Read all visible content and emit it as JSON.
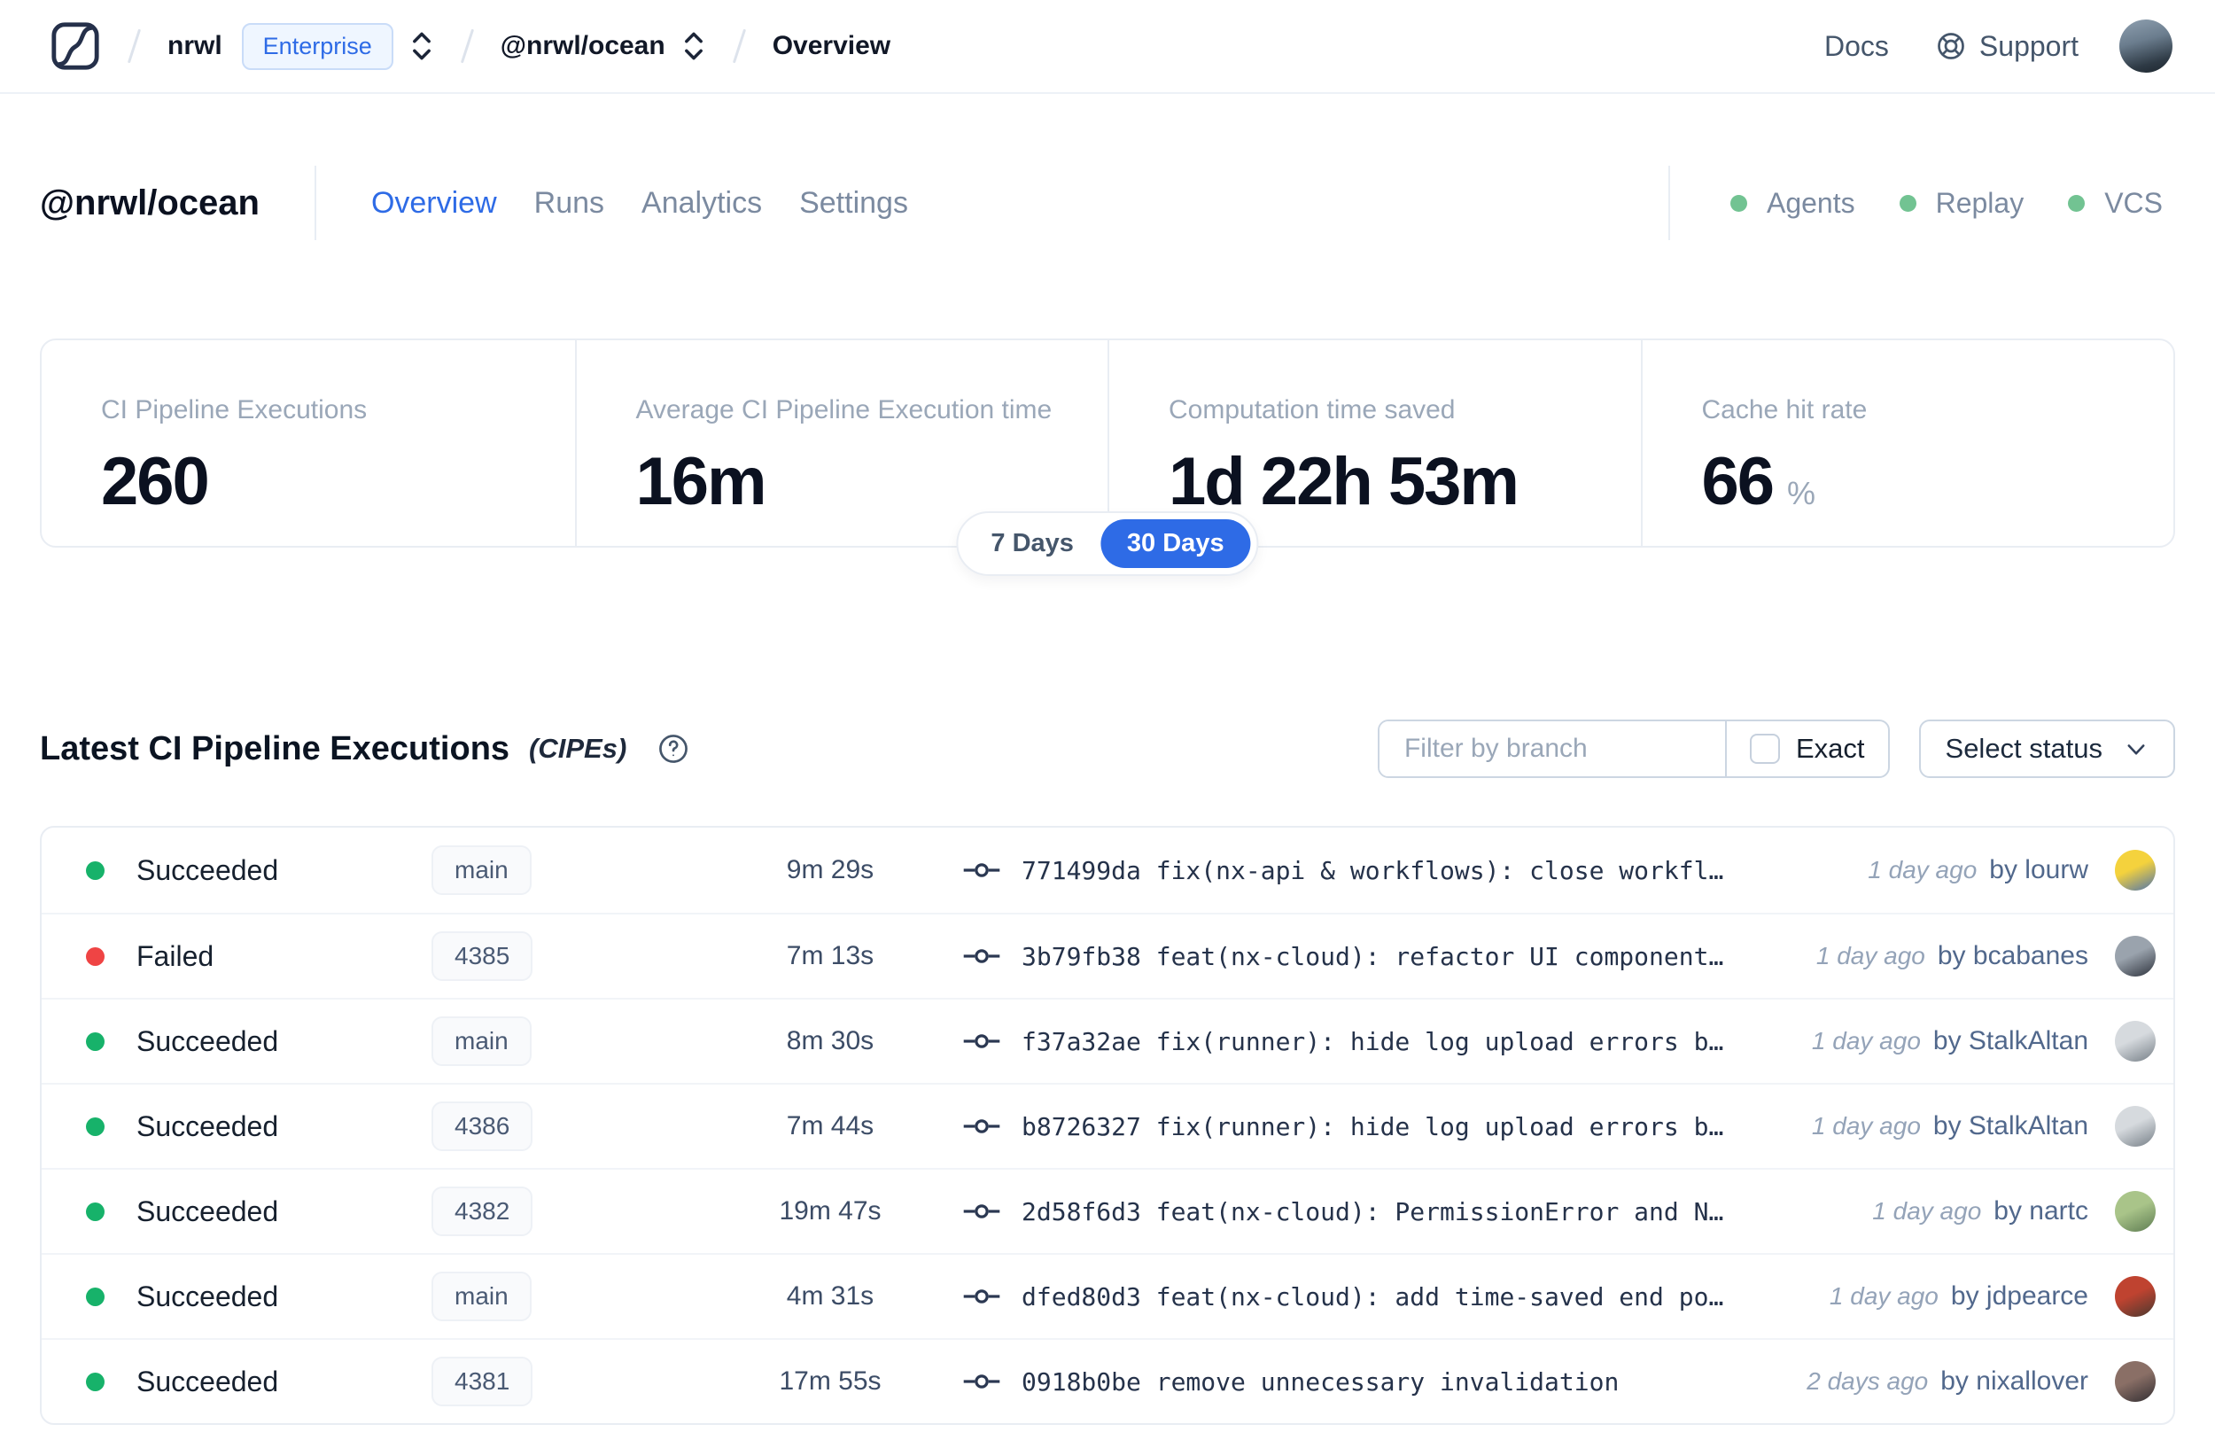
{
  "nav": {
    "breadcrumb": {
      "org": "nrwl",
      "org_badge": "Enterprise",
      "workspace": "@nrwl/ocean",
      "page": "Overview"
    },
    "docs_label": "Docs",
    "support_label": "Support"
  },
  "workspace": {
    "title": "@nrwl/ocean",
    "tabs": [
      {
        "label": "Overview",
        "active": true
      },
      {
        "label": "Runs",
        "active": false
      },
      {
        "label": "Analytics",
        "active": false
      },
      {
        "label": "Settings",
        "active": false
      }
    ],
    "indicators": [
      {
        "label": "Agents"
      },
      {
        "label": "Replay"
      },
      {
        "label": "VCS"
      }
    ]
  },
  "stats": {
    "cards": [
      {
        "label": "CI Pipeline Executions",
        "value": "260",
        "suffix": ""
      },
      {
        "label": "Average CI Pipeline Execution time",
        "value": "16m",
        "suffix": ""
      },
      {
        "label": "Computation time saved",
        "value": "1d 22h 53m",
        "suffix": ""
      },
      {
        "label": "Cache hit rate",
        "value": "66",
        "suffix": "%"
      }
    ],
    "range_toggle": {
      "options": [
        "7 Days",
        "30 Days"
      ],
      "selected": "30 Days"
    }
  },
  "cipe_section": {
    "title": "Latest CI Pipeline Executions",
    "title_suffix": "(CIPEs)",
    "filter": {
      "branch_placeholder": "Filter by branch",
      "exact_label": "Exact",
      "status_label": "Select status"
    },
    "rows": [
      {
        "status": "Succeeded",
        "failed": false,
        "branch": "main",
        "duration": "9m 29s",
        "commit": "771499da",
        "message": "fix(nx-api & workflows): close workfl…",
        "time_ago": "1 day ago",
        "author": "by lourw",
        "avatar": [
          "#f4d23d",
          "#4f74ad"
        ]
      },
      {
        "status": "Failed",
        "failed": true,
        "branch": "4385",
        "duration": "7m 13s",
        "commit": "3b79fb38",
        "message": "feat(nx-cloud): refactor UI component…",
        "time_ago": "1 day ago",
        "author": "by bcabanes",
        "avatar": [
          "#9aa3ad",
          "#2e333d"
        ]
      },
      {
        "status": "Succeeded",
        "failed": false,
        "branch": "main",
        "duration": "8m 30s",
        "commit": "f37a32ae",
        "message": "fix(runner): hide log upload errors b…",
        "time_ago": "1 day ago",
        "author": "by StalkAltan",
        "avatar": [
          "#d6dade",
          "#767f87"
        ]
      },
      {
        "status": "Succeeded",
        "failed": false,
        "branch": "4386",
        "duration": "7m 44s",
        "commit": "b8726327",
        "message": "fix(runner): hide log upload errors b…",
        "time_ago": "1 day ago",
        "author": "by StalkAltan",
        "avatar": [
          "#d6dade",
          "#767f87"
        ]
      },
      {
        "status": "Succeeded",
        "failed": false,
        "branch": "4382",
        "duration": "19m 47s",
        "commit": "2d58f6d3",
        "message": "feat(nx-cloud): PermissionError and N…",
        "time_ago": "1 day ago",
        "author": "by nartc",
        "avatar": [
          "#a9c489",
          "#5e7c52"
        ]
      },
      {
        "status": "Succeeded",
        "failed": false,
        "branch": "main",
        "duration": "4m 31s",
        "commit": "dfed80d3",
        "message": "feat(nx-cloud): add time-saved end po…",
        "time_ago": "1 day ago",
        "author": "by jdpearce",
        "avatar": [
          "#bf4330",
          "#49392f"
        ]
      },
      {
        "status": "Succeeded",
        "failed": false,
        "branch": "4381",
        "duration": "17m 55s",
        "commit": "0918b0be",
        "message": "remove unnecessary invalidation",
        "time_ago": "2 days ago",
        "author": "by nixallover",
        "avatar": [
          "#8a6f66",
          "#322e32"
        ]
      }
    ]
  },
  "colors": {
    "accent_blue": "#2e6be6",
    "success_green": "#17b26a",
    "failed_red": "#ef4444",
    "indicator_green": "#72c392"
  }
}
